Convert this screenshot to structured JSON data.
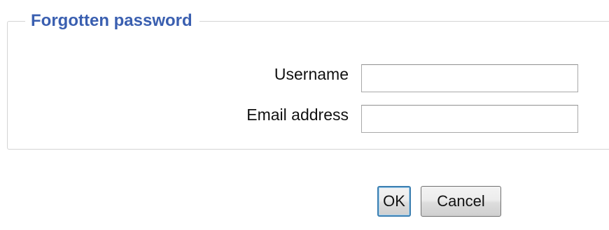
{
  "form": {
    "legend": "Forgotten password",
    "fields": [
      {
        "label": "Username",
        "value": "",
        "placeholder": ""
      },
      {
        "label": "Email address",
        "value": "",
        "placeholder": ""
      }
    ]
  },
  "buttons": {
    "ok_label": "OK",
    "cancel_label": "Cancel"
  },
  "colors": {
    "legend_text": "#3a5fb0",
    "fieldset_border": "#d4d4d4",
    "ok_focus_border": "#3c7fb1"
  }
}
